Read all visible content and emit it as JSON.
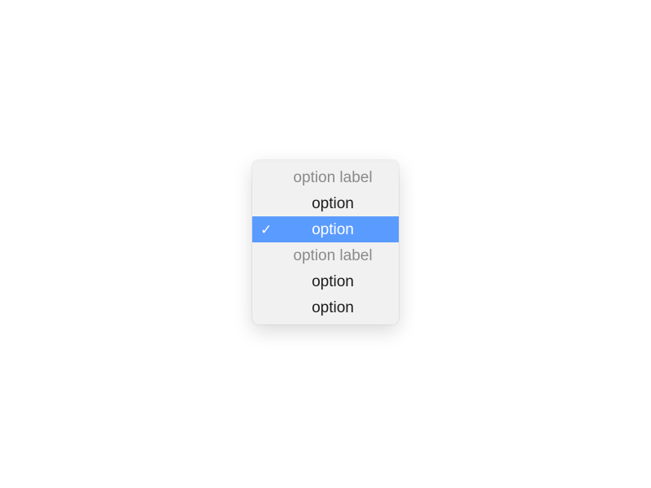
{
  "menu": {
    "groups": [
      {
        "label": "option label",
        "options": [
          {
            "label": "option",
            "selected": false
          },
          {
            "label": "option",
            "selected": true
          }
        ]
      },
      {
        "label": "option label",
        "options": [
          {
            "label": "option",
            "selected": false
          },
          {
            "label": "option",
            "selected": false
          }
        ]
      }
    ]
  }
}
